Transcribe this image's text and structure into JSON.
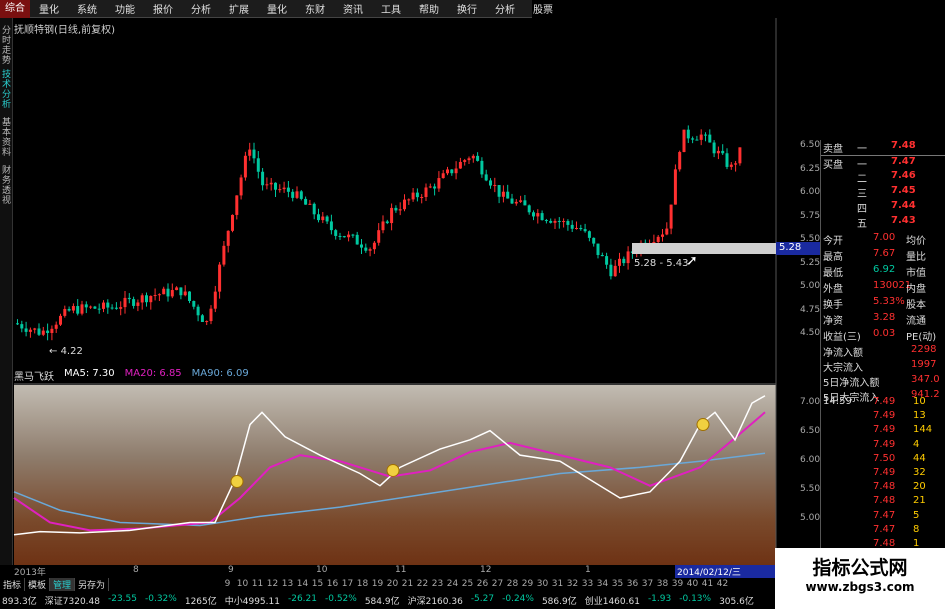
{
  "menu": {
    "items": [
      "综合",
      "量化",
      "系统",
      "功能",
      "报价",
      "分析",
      "扩展",
      "量化",
      "东财",
      "资讯",
      "工具",
      "帮助",
      "换行",
      "分析",
      "股票"
    ]
  },
  "stock_title": "抚顺特钢(日线,前复权)",
  "side_tabs": [
    "分时走势",
    "技术分析",
    "基本资料",
    "财务透视"
  ],
  "price_labels": {
    "low": "4.22",
    "range": "5.28 - 5.43",
    "cursor": "5.28"
  },
  "y_axis_upper": [
    "6.50",
    "6.25",
    "6.00",
    "5.75",
    "5.50",
    "5.25",
    "5.00",
    "4.75",
    "4.50"
  ],
  "y_axis_lower": [
    "7.00",
    "6.50",
    "6.00",
    "5.50",
    "5.00"
  ],
  "indicator": {
    "name": "黑马飞跃",
    "ma5": "MA5: 7.30",
    "ma20": "MA20: 6.85",
    "ma90": "MA90: 6.09"
  },
  "order_book": {
    "rows": [
      {
        "label": "卖盘",
        "tag": "一",
        "price": "7.48"
      },
      {
        "label": "买盘",
        "tag": "一",
        "price": "7.47"
      },
      {
        "label": "",
        "tag": "二",
        "price": "7.46"
      },
      {
        "label": "",
        "tag": "三",
        "price": "7.45"
      },
      {
        "label": "",
        "tag": "四",
        "price": "7.44"
      },
      {
        "label": "",
        "tag": "五",
        "price": "7.43"
      }
    ]
  },
  "stats": [
    {
      "a": "今开",
      "av": "7.00",
      "b": "均价"
    },
    {
      "a": "最高",
      "av": "7.67",
      "b": "量比"
    },
    {
      "a": "最低",
      "av": "6.92",
      "b": "市值"
    },
    {
      "a": "外盘",
      "av": "130021",
      "b": "内盘"
    },
    {
      "a": "换手",
      "av": "5.33%",
      "b": "股本"
    },
    {
      "a": "净资",
      "av": "3.28",
      "b": "流通"
    },
    {
      "a": "收益(三)",
      "av": "0.03",
      "b": "PE(动)"
    }
  ],
  "flows": [
    {
      "label": "净流入额",
      "value": "2298"
    },
    {
      "label": "大宗流入",
      "value": "1997"
    },
    {
      "label": "5日净流入额",
      "value": "347.0"
    },
    {
      "label": "5日大宗流入",
      "value": "941.2"
    }
  ],
  "ticks": [
    {
      "time": "14:59",
      "price": "7.49",
      "vol": "10"
    },
    {
      "time": "",
      "price": "7.49",
      "vol": "13"
    },
    {
      "time": "",
      "price": "7.49",
      "vol": "144"
    },
    {
      "time": "",
      "price": "7.49",
      "vol": "4"
    },
    {
      "time": "",
      "price": "7.50",
      "vol": "44"
    },
    {
      "time": "",
      "price": "7.49",
      "vol": "32"
    },
    {
      "time": "",
      "price": "7.48",
      "vol": "20"
    },
    {
      "time": "",
      "price": "7.48",
      "vol": "21"
    },
    {
      "time": "",
      "price": "7.47",
      "vol": "5"
    },
    {
      "time": "",
      "price": "7.47",
      "vol": "8"
    },
    {
      "time": "",
      "price": "7.48",
      "vol": "1"
    },
    {
      "time": "",
      "price": "7.48",
      "vol": "5"
    }
  ],
  "x_axis": {
    "year": "2013年",
    "months": [
      "8",
      "9",
      "10",
      "11",
      "12",
      "1"
    ],
    "date_box": "2014/02/12/三"
  },
  "bottom_tabs": [
    "指标",
    "模板",
    "管理",
    "另存为"
  ],
  "day_numbers": [
    "9",
    "10",
    "11",
    "12",
    "13",
    "14",
    "15",
    "16",
    "17",
    "18",
    "19",
    "20",
    "21",
    "22",
    "23",
    "24",
    "25",
    "26",
    "27",
    "28",
    "29",
    "30",
    "31",
    "32",
    "33",
    "34",
    "35",
    "36",
    "37",
    "38",
    "39",
    "40",
    "41",
    "42"
  ],
  "ticker": [
    "893.3亿",
    "深证7320.48",
    "-23.55",
    "-0.32%",
    "1265亿",
    "中小4995.11",
    "-26.21",
    "-0.52%",
    "584.9亿",
    "沪深2160.36",
    "-5.27",
    "-0.24%",
    "586.9亿",
    "创业1460.61",
    "-1.93",
    "-0.13%",
    "305.6亿"
  ],
  "watermark": {
    "title": "指标公式网",
    "url": "www.zbgs3.com"
  },
  "colors": {
    "up": "#ff3030",
    "down": "#00c8a0",
    "ma5": "#ffffff",
    "ma20": "#e020c0",
    "ma90": "#6aa8d8",
    "cyan": "#2ad0d0"
  }
}
